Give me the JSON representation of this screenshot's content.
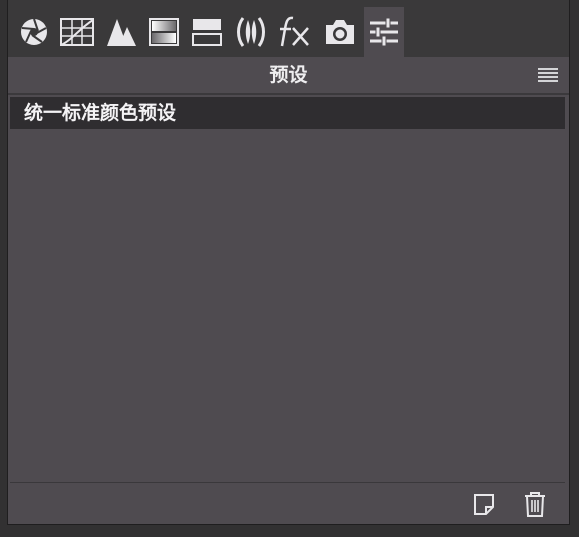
{
  "tabs": [
    {
      "id": "basic",
      "icon": "aperture-icon"
    },
    {
      "id": "tone-curve",
      "icon": "tone-curve-grid-icon"
    },
    {
      "id": "detail",
      "icon": "detail-triangles-icon"
    },
    {
      "id": "hsl",
      "icon": "hsl-gradient-icon"
    },
    {
      "id": "split-toning",
      "icon": "split-toning-icon"
    },
    {
      "id": "lens-corrections",
      "icon": "lens-icon"
    },
    {
      "id": "effects",
      "icon": "fx-icon"
    },
    {
      "id": "camera-calibration",
      "icon": "camera-icon"
    },
    {
      "id": "presets",
      "icon": "sliders-icon",
      "active": true
    }
  ],
  "header": {
    "title": "预设"
  },
  "presets": {
    "items": [
      {
        "label": "统一标准颜色预设",
        "selected": true
      }
    ]
  },
  "footer": {
    "new_icon": "new-preset-icon",
    "delete_icon": "trash-icon"
  },
  "colors": {
    "panel_bg": "#4f4b50",
    "tabbar_bg": "#3a393a",
    "selected_row": "#2f2d30",
    "icon": "#e8e7ea"
  }
}
